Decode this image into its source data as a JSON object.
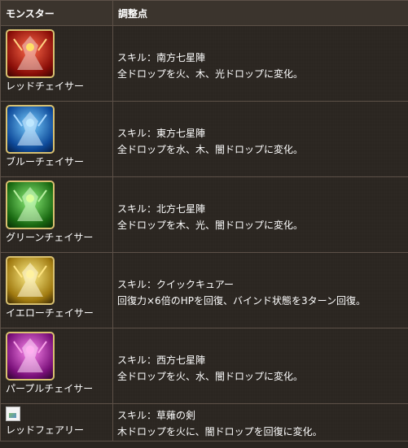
{
  "header": {
    "monster": "モンスター",
    "adjustment": "調整点"
  },
  "rows": [
    {
      "name": "レッドチェイサー",
      "skill": "スキル：南方七星陣",
      "effect": "全ドロップを火、木、光ドロップに変化。",
      "icon_color": "#c8281e"
    },
    {
      "name": "ブルーチェイサー",
      "skill": "スキル：東方七星陣",
      "effect": "全ドロップを水、木、闇ドロップに変化。",
      "icon_color": "#1e6ec8"
    },
    {
      "name": "グリーンチェイサー",
      "skill": "スキル：北方七星陣",
      "effect": "全ドロップを木、光、闇ドロップに変化。",
      "icon_color": "#2e9a2a"
    },
    {
      "name": "イエローチェイサー",
      "skill": "スキル：クイックキュアー",
      "effect": "回復力×6倍のHPを回復、バインド状態を3ターン回復。",
      "icon_color": "#d8b428"
    },
    {
      "name": "パープルチェイサー",
      "skill": "スキル：西方七星陣",
      "effect": "全ドロップを火、水、闇ドロップに変化。",
      "icon_color": "#b02ea8"
    },
    {
      "name": "レッドフェアリー",
      "skill": "スキル：草薙の剣",
      "effect": "木ドロップを火に、闇ドロップを回復に変化。",
      "icon_color": ""
    }
  ]
}
